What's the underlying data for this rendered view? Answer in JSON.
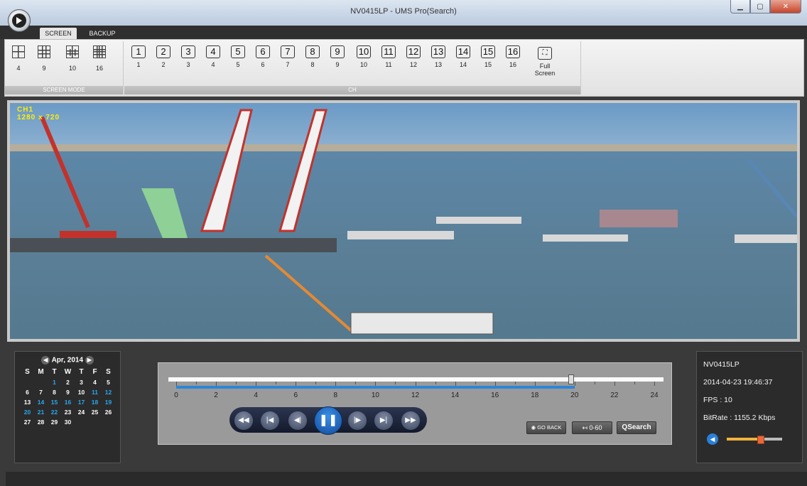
{
  "window": {
    "title": "NV0415LP - UMS Pro(Search)"
  },
  "tabs": [
    {
      "label": "SCREEN"
    },
    {
      "label": "BACKUP"
    }
  ],
  "screen_mode": {
    "group_label": "SCREEN MODE",
    "items": [
      {
        "label": "4"
      },
      {
        "label": "9"
      },
      {
        "label": "10"
      },
      {
        "label": "16"
      }
    ]
  },
  "channels": {
    "group_label": "CH",
    "items": [
      {
        "label": "1"
      },
      {
        "label": "2"
      },
      {
        "label": "3"
      },
      {
        "label": "4"
      },
      {
        "label": "5"
      },
      {
        "label": "6"
      },
      {
        "label": "7"
      },
      {
        "label": "8"
      },
      {
        "label": "9"
      },
      {
        "label": "10"
      },
      {
        "label": "11"
      },
      {
        "label": "12"
      },
      {
        "label": "13"
      },
      {
        "label": "14"
      },
      {
        "label": "15"
      },
      {
        "label": "16"
      }
    ]
  },
  "fullscreen": {
    "label": "Full Screen"
  },
  "video": {
    "osd_channel": "CH1",
    "osd_resolution": "1280 x 720"
  },
  "calendar": {
    "month_label": "Apr, 2014",
    "days_of_week": [
      "S",
      "M",
      "T",
      "W",
      "T",
      "F",
      "S"
    ],
    "weeks": [
      [
        "",
        "",
        "1",
        "2",
        "3",
        "4",
        "5"
      ],
      [
        "6",
        "7",
        "8",
        "9",
        "10",
        "11",
        "12"
      ],
      [
        "13",
        "14",
        "15",
        "16",
        "17",
        "18",
        "19"
      ],
      [
        "20",
        "21",
        "22",
        "23",
        "24",
        "25",
        "26"
      ],
      [
        "27",
        "28",
        "29",
        "30",
        "",
        "",
        ""
      ]
    ],
    "highlighted_days": [
      "1",
      "11",
      "12",
      "14",
      "15",
      "16",
      "17",
      "18",
      "19",
      "20",
      "21",
      "22"
    ]
  },
  "timeline": {
    "labels": [
      "0",
      "2",
      "4",
      "6",
      "8",
      "10",
      "12",
      "14",
      "16",
      "18",
      "20",
      "22",
      "24"
    ],
    "recorded_until_hour": 20,
    "position_hour": 19.8
  },
  "playback": {
    "buttons": [
      {
        "name": "fast-rewind",
        "glyph": "◀◀"
      },
      {
        "name": "previous",
        "glyph": "|◀"
      },
      {
        "name": "step-back",
        "glyph": "◀|"
      },
      {
        "name": "pause",
        "glyph": "❚❚"
      },
      {
        "name": "step-forward",
        "glyph": "|▶"
      },
      {
        "name": "next",
        "glyph": "▶|"
      },
      {
        "name": "fast-forward",
        "glyph": "▶▶"
      }
    ]
  },
  "controls": {
    "go_back": "GO BACK",
    "range": "0-60",
    "qsearch": "QSearch"
  },
  "info": {
    "device": "NV0415LP",
    "datetime": "2014-04-23 19:46:37",
    "fps": "FPS : 10",
    "bitrate": "BitRate : 1155.2 Kbps",
    "volume_level": 0.6
  }
}
